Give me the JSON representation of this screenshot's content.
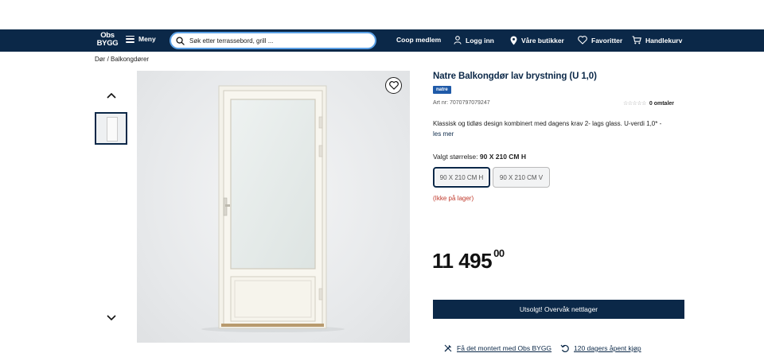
{
  "header": {
    "logo_line1": "Obs",
    "logo_line2": "BYGG",
    "menu_label": "Meny",
    "search_placeholder": "Søk etter terrassebord, grill ...",
    "coop_label": "Coop medlem",
    "login_label": "Logg inn",
    "stores_label": "Våre butikker",
    "favorites_label": "Favoritter",
    "cart_label": "Handlekurv"
  },
  "breadcrumb": {
    "item1": "Dør",
    "separator": "/",
    "item2": "Balkongdører"
  },
  "product": {
    "title": "Natre Balkongdør lav brystning (U 1,0)",
    "brand": "natre",
    "art_nr": "Art nr: 7070797079247",
    "stars": "☆☆☆☆☆",
    "reviews": "0 omtaler",
    "description": "Klassisk og tidløs design kombinert med dagens krav 2- lags glass. U-verdi 1,0* -",
    "read_more": "les mer",
    "size_label": "Valgt størrelse:",
    "size_selected": "90 X 210 CM H",
    "sizes": [
      "90 X 210 CM H",
      "90 X 210 CM V"
    ],
    "stock_status": "(Ikke på lager)",
    "price_main": "11 495",
    "price_cents": "00",
    "cta_label": "Utsolgt! Overvåk nettlager"
  },
  "footer_links": {
    "mount": "Få det montert med Obs BYGG",
    "return": "120 dagers åpent kjøp"
  },
  "colors": {
    "navy": "#0b2848",
    "accent": "#5aa0e6",
    "stock_red": "#c0392b"
  }
}
